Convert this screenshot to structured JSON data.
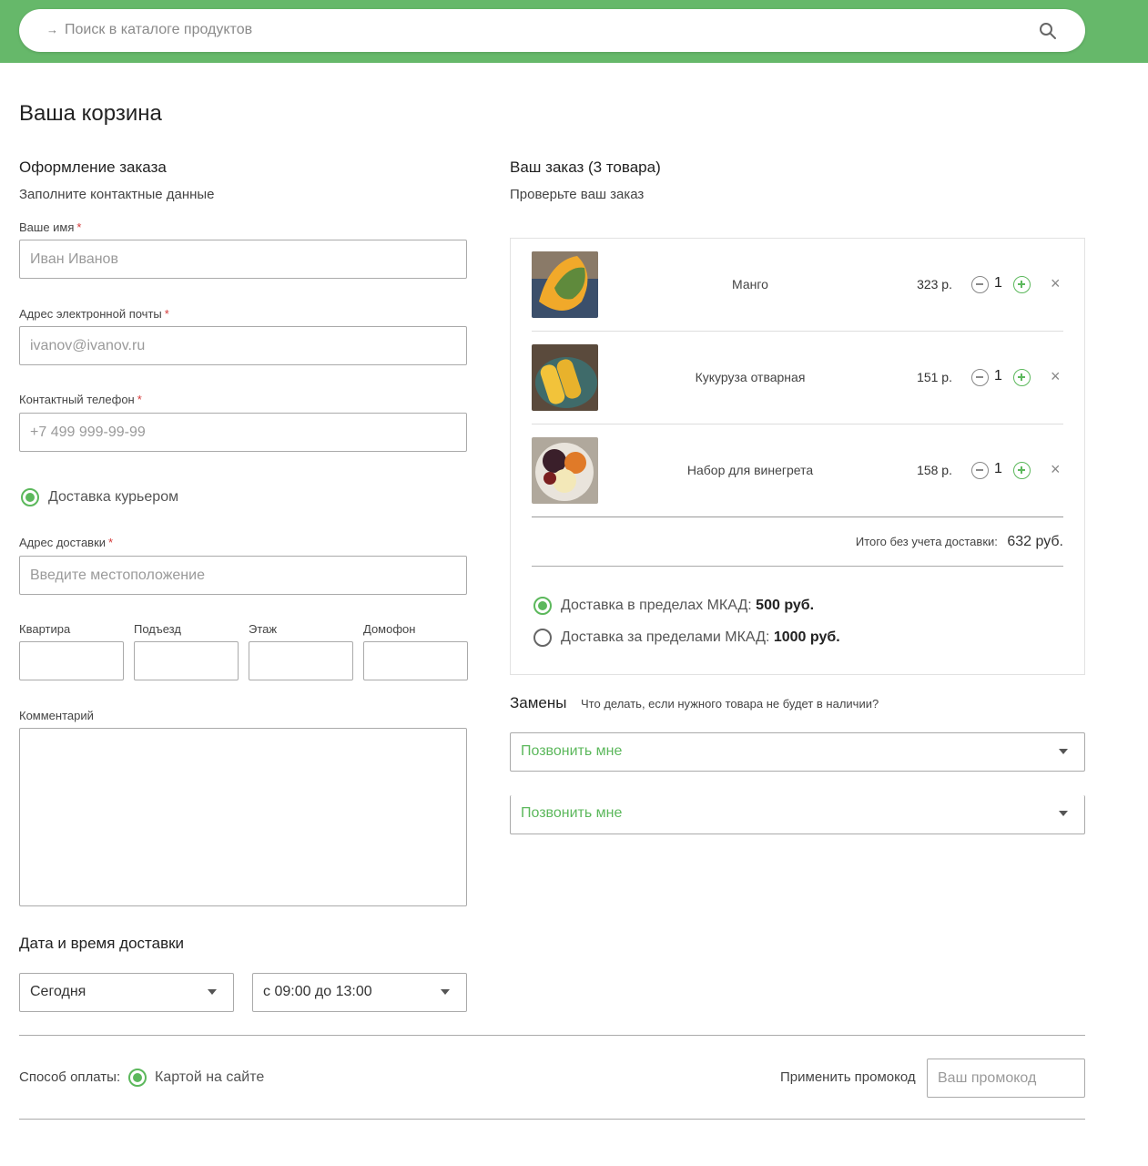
{
  "search": {
    "placeholder": "Поиск в каталоге продуктов",
    "arrow_icon": "→",
    "search_icon": "search-icon"
  },
  "page": {
    "title": "Ваша корзина"
  },
  "checkout": {
    "title": "Оформление заказа",
    "subtitle": "Заполните контактные данные",
    "name_label": "Ваше имя",
    "name_placeholder": "Иван Иванов",
    "email_label": "Адрес электронной почты",
    "email_placeholder": "ivanov@ivanov.ru",
    "phone_label": "Контактный телефон",
    "phone_placeholder": "+7 499 999-99-99",
    "required_mark": "*",
    "delivery_method": "Доставка курьером",
    "address_label": "Адрес доставки",
    "address_placeholder": "Введите местоположение",
    "apartment_label": "Квартира",
    "entrance_label": "Подъезд",
    "floor_label": "Этаж",
    "intercom_label": "Домофон",
    "comment_label": "Комментарий",
    "datetime_title": "Дата и время доставки",
    "date_value": "Сегодня",
    "time_value": "с 09:00 до 13:00"
  },
  "order": {
    "title": "Ваш заказ (3 товара)",
    "subtitle": "Проверьте ваш заказ",
    "items": [
      {
        "name": "Манго",
        "price": "323 р.",
        "qty": "1"
      },
      {
        "name": "Кукуруза отварная",
        "price": "151 р.",
        "qty": "1"
      },
      {
        "name": "Набор для винегрета",
        "price": "158 р.",
        "qty": "1"
      }
    ],
    "remove_icon": "×",
    "total_label": "Итого без учета доставки:",
    "total_value": "632 руб.",
    "delivery_options": [
      {
        "label": "Доставка в пределах МКАД: ",
        "price": "500 руб.",
        "selected": true
      },
      {
        "label": "Доставка за пределами МКАД: ",
        "price": "1000 руб.",
        "selected": false
      }
    ]
  },
  "replacements": {
    "title": "Замены",
    "hint": "Что делать, если нужного товара не будет в наличии?",
    "select1": "Позвонить мне",
    "select2": "Позвонить мне"
  },
  "payment": {
    "label": "Способ оплаты:",
    "option": "Картой на сайте",
    "promo_label": "Применить промокод",
    "promo_placeholder": "Ваш промокод"
  },
  "colors": {
    "header": "#66b86a",
    "accent": "#5cb85c",
    "required": "#d43a3a"
  }
}
